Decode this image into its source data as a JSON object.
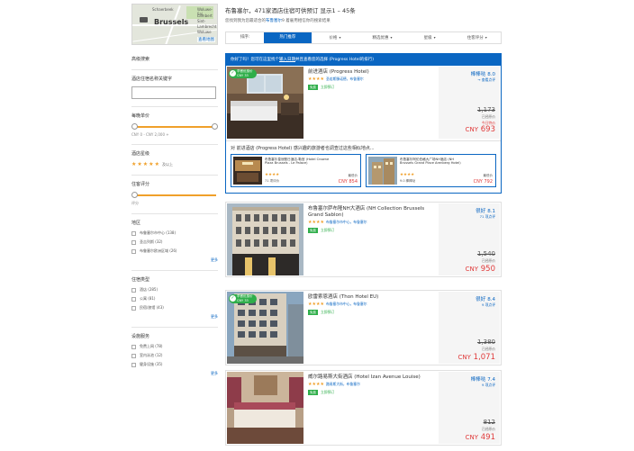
{
  "map": {
    "city": "Brussels",
    "labels": [
      "Schaerbeek",
      "Woluwe-Sai",
      "Lambert",
      "Sint-",
      "Lambrecht",
      "Woluwe"
    ],
    "view_map": "查看地图"
  },
  "header": {
    "title": "布鲁塞尔，471家酒店住宿可供预订 显示1 – 45条",
    "subtitle_pre": "您找到我为您最适合的",
    "subtitle_link": "布鲁塞尔",
    "subtitle_post": "9 着雇用相信你的搜索结果"
  },
  "sortbar": {
    "items": [
      {
        "label": "排序:",
        "active": false,
        "caret": false
      },
      {
        "label": "热门推荐",
        "active": true,
        "caret": false
      },
      {
        "label": "价格",
        "active": false,
        "caret": true
      },
      {
        "label": "精选优惠",
        "active": false,
        "caret": true
      },
      {
        "label": "星级",
        "active": false,
        "caret": true
      },
      {
        "label": "住客评分",
        "active": false,
        "caret": true
      }
    ]
  },
  "sidebar": {
    "filter_title": "高级搜索",
    "name_search_label": "酒店住宿名称关键字",
    "price_label": "每晚单价",
    "price_range": "CNY 0 - CNY 2,000 +",
    "star_label": "酒店星级",
    "star_suffix": "及以上",
    "score_label": "住客评分",
    "score_min": "评分",
    "district_label": "地区",
    "districts": [
      "布鲁塞尔市中心 (138)",
      "圣吉列斯 (32)",
      "布鲁塞尔欧洲区域 (26)"
    ],
    "type_label": "住宿类型",
    "types": [
      "酒店 (285)",
      "公寓 (81)",
      "民宿/旅馆 (43)"
    ],
    "facility_label": "设施服务",
    "facilities": [
      "免费上网 (78)",
      "室内泳池 (12)",
      "健身设施 (35)"
    ],
    "more": "更多"
  },
  "featured": {
    "banner_pre": "你好了吗！您可在这里找个",
    "banner_link": "输入日期",
    "banner_post": "并且查看您的选择 (Progress Hotel的排行)",
    "hotel": {
      "name": "前进酒店 (Progress Hotel)",
      "stars": "★★★★",
      "location": "圣若斯滕诺德，布鲁塞尔",
      "tag": "免费",
      "tag_text": "立即预订",
      "deal": "早餐优惠价",
      "deal_price": "CNY 33",
      "score_word": "棒棒哒",
      "score": "8.0",
      "reviews": "→ 查看点评",
      "orig": "1,173",
      "orig_note": "已经原价",
      "price": "693",
      "price_note": "今日特价",
      "currency": "CNY"
    },
    "compare_title": "对 前进酒店 (Progress Hotel) 感兴趣的旅游者也调查过这些相似地点...",
    "compare": [
      {
        "name": "布鲁塞尔皇冠假日酒店-勒宫 (Hotel Crowne Plaza Brussels - Le Palace)",
        "stars": "★★★★",
        "reviews": "71 项评价",
        "price_label": "最低价",
        "price": "CNY 854"
      },
      {
        "name": "布鲁塞尔阿伦伯格大广场NH酒店 (NH Brussels Grand Place Arenberg Hotel)",
        "stars": "★★★★",
        "reviews": "9.0 棒棒哒",
        "price_label": "最低价",
        "price": "CNY 792"
      }
    ]
  },
  "results": [
    {
      "name": "布鲁塞尔萨布隆NH大酒店 (NH Collection Brussels Grand Sablon)",
      "stars": "★★★★",
      "location": "布鲁塞尔市中心，布鲁塞尔",
      "tag": "免费",
      "tag_text": "立即预订",
      "score_word": "很好",
      "score": "8.1",
      "reviews": "71 项点评",
      "orig": "1,540",
      "orig_note": "已经原价",
      "price": "950",
      "currency": "CNY",
      "deal": null
    },
    {
      "name": "欧雷索恩酒店 (Thon Hotel EU)",
      "stars": "★★★★",
      "location": "布鲁塞尔市中心，布鲁塞尔",
      "tag": "免费",
      "tag_text": "立即预订",
      "score_word": "很好",
      "score": "8.4",
      "reviews": "9 项点评",
      "orig": "1,380",
      "orig_note": "已经原价",
      "price": "1,071",
      "currency": "CNY",
      "deal": "早餐优惠价",
      "deal_price": "CNY 33"
    },
    {
      "name": "威尔路易斯大街酒店 (Hotel Izan Avenue Louise)",
      "stars": "★★★★",
      "location": "路易斯大街，布鲁塞尔",
      "tag": "免费",
      "tag_text": "立即预订",
      "score_word": "棒棒哒",
      "score": "7.4",
      "reviews": "9 项点评",
      "orig": "812",
      "orig_note": "已经原价",
      "price": "491",
      "currency": "CNY",
      "deal": null
    }
  ]
}
